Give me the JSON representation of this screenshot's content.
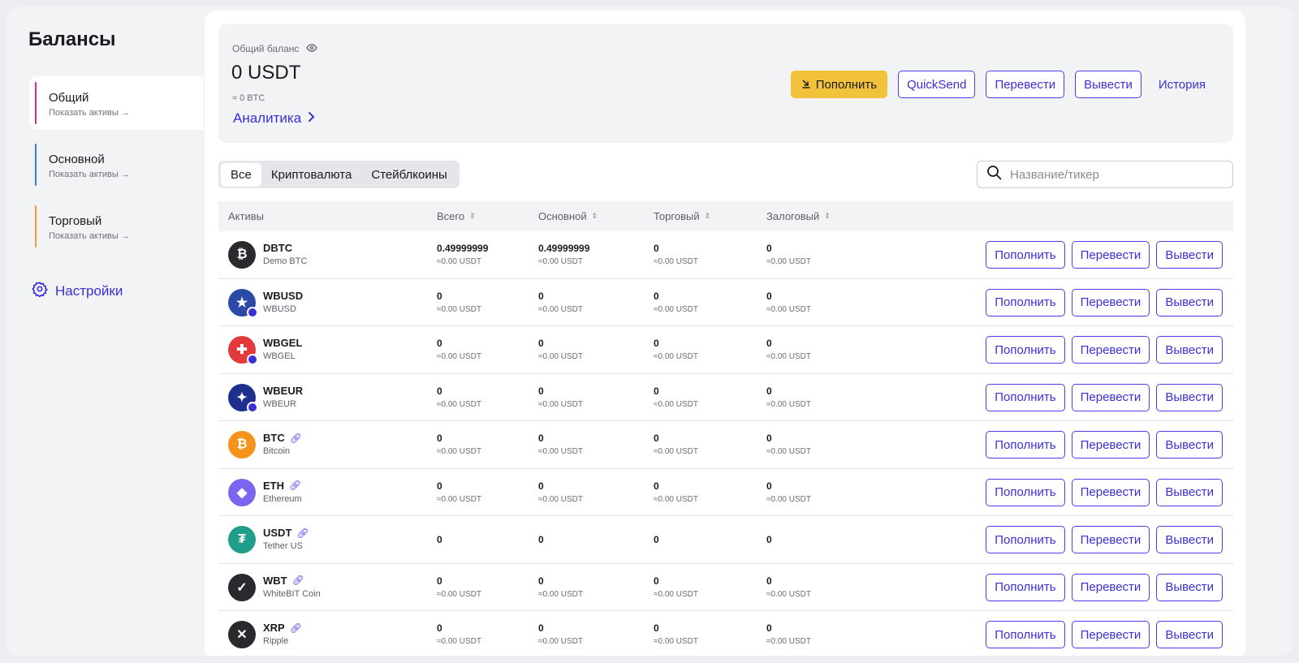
{
  "sidebar": {
    "title": "Балансы",
    "accounts": [
      {
        "name": "Общий",
        "sub": "Показать активы →",
        "color": "#e0269b"
      },
      {
        "name": "Основной",
        "sub": "Показать активы →",
        "color": "#3b7bf0"
      },
      {
        "name": "Торговый",
        "sub": "Показать активы →",
        "color": "#f29a3b"
      }
    ],
    "settings_label": "Настройки"
  },
  "balance": {
    "label": "Общий баланс",
    "amount": "0 USDT",
    "btc": "≈ 0 BTC",
    "analytics": "Аналитика"
  },
  "actions": {
    "deposit": "Пополнить",
    "quicksend": "QuickSend",
    "transfer": "Перевести",
    "withdraw": "Вывести",
    "history": "История"
  },
  "tabs": [
    "Все",
    "Криптовалюта",
    "Стейблкоины"
  ],
  "search": {
    "placeholder": "Название/тикер"
  },
  "columns": [
    "Активы",
    "Всего",
    "Основной",
    "Торговый",
    "Залоговый"
  ],
  "row_buttons": {
    "deposit": "Пополнить",
    "transfer": "Перевести",
    "withdraw": "Вывести"
  },
  "assets": [
    {
      "ticker": "DBTC",
      "name": "Demo BTC",
      "icon": "demo-btc-icon",
      "color": "#2a2a2e",
      "linked": false,
      "total": "0.49999999",
      "total_usdt": "≈0.00 USDT",
      "main": "0.49999999",
      "main_usdt": "≈0.00 USDT",
      "trade": "0",
      "trade_usdt": "≈0.00 USDT",
      "collateral": "0",
      "collateral_usdt": "≈0.00 USDT"
    },
    {
      "ticker": "WBUSD",
      "name": "WBUSD",
      "icon": "us-flag-icon",
      "color": "#2b4aa8",
      "linked": false,
      "total": "0",
      "total_usdt": "≈0.00 USDT",
      "main": "0",
      "main_usdt": "≈0.00 USDT",
      "trade": "0",
      "trade_usdt": "≈0.00 USDT",
      "collateral": "0",
      "collateral_usdt": "≈0.00 USDT"
    },
    {
      "ticker": "WBGEL",
      "name": "WBGEL",
      "icon": "georgia-flag-icon",
      "color": "#e23a3a",
      "linked": false,
      "total": "0",
      "total_usdt": "≈0.00 USDT",
      "main": "0",
      "main_usdt": "≈0.00 USDT",
      "trade": "0",
      "trade_usdt": "≈0.00 USDT",
      "collateral": "0",
      "collateral_usdt": "≈0.00 USDT"
    },
    {
      "ticker": "WBEUR",
      "name": "WBEUR",
      "icon": "eu-flag-icon",
      "color": "#1f2f8f",
      "linked": false,
      "total": "0",
      "total_usdt": "≈0.00 USDT",
      "main": "0",
      "main_usdt": "≈0.00 USDT",
      "trade": "0",
      "trade_usdt": "≈0.00 USDT",
      "collateral": "0",
      "collateral_usdt": "≈0.00 USDT"
    },
    {
      "ticker": "BTC",
      "name": "Bitcoin",
      "icon": "bitcoin-icon",
      "color": "#f7931a",
      "linked": true,
      "total": "0",
      "total_usdt": "≈0.00 USDT",
      "main": "0",
      "main_usdt": "≈0.00 USDT",
      "trade": "0",
      "trade_usdt": "≈0.00 USDT",
      "collateral": "0",
      "collateral_usdt": "≈0.00 USDT"
    },
    {
      "ticker": "ETH",
      "name": "Ethereum",
      "icon": "ethereum-icon",
      "color": "#7b64f0",
      "linked": true,
      "total": "0",
      "total_usdt": "≈0.00 USDT",
      "main": "0",
      "main_usdt": "≈0.00 USDT",
      "trade": "0",
      "trade_usdt": "≈0.00 USDT",
      "collateral": "0",
      "collateral_usdt": "≈0.00 USDT"
    },
    {
      "ticker": "USDT",
      "name": "Tether US",
      "icon": "tether-icon",
      "color": "#1f9e8a",
      "linked": true,
      "total": "0",
      "total_usdt": "",
      "main": "0",
      "main_usdt": "",
      "trade": "0",
      "trade_usdt": "",
      "collateral": "0",
      "collateral_usdt": ""
    },
    {
      "ticker": "WBT",
      "name": "WhiteBIT Coin",
      "icon": "whitebit-coin-icon",
      "color": "#2a2a2e",
      "linked": true,
      "total": "0",
      "total_usdt": "≈0.00 USDT",
      "main": "0",
      "main_usdt": "≈0.00 USDT",
      "trade": "0",
      "trade_usdt": "≈0.00 USDT",
      "collateral": "0",
      "collateral_usdt": "≈0.00 USDT"
    },
    {
      "ticker": "XRP",
      "name": "Ripple",
      "icon": "xrp-icon",
      "color": "#2a2a2e",
      "linked": true,
      "total": "0",
      "total_usdt": "≈0.00 USDT",
      "main": "0",
      "main_usdt": "≈0.00 USDT",
      "trade": "0",
      "trade_usdt": "≈0.00 USDT",
      "collateral": "0",
      "collateral_usdt": "≈0.00 USDT"
    }
  ]
}
